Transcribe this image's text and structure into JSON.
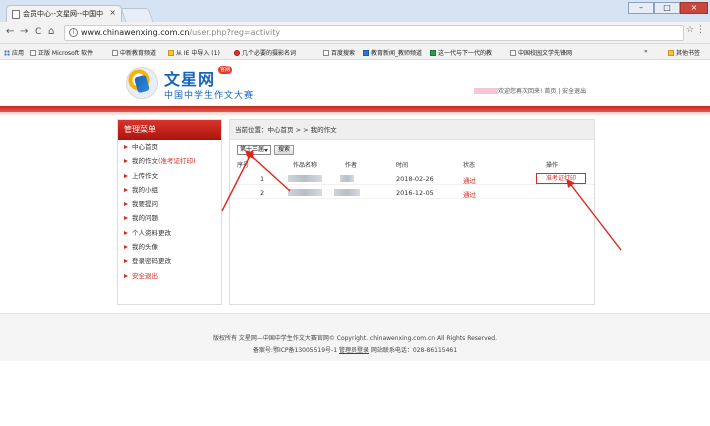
{
  "browser": {
    "tab_title": "会员中心--文星网--中国中",
    "tab_close": "×",
    "window_controls": {
      "minimize": "–",
      "maximize": "□",
      "close": "×"
    },
    "nav": {
      "back": "←",
      "forward": "→",
      "reload": "C",
      "home": "⌂"
    },
    "url_host": "www.chinawenxing.com.cn",
    "url_path": "/user.php?reg=activity",
    "bookmarks": [
      {
        "label": "应用",
        "icon": "apps-icon"
      },
      {
        "label": "正版 Microsoft 软件",
        "icon": "page-icon"
      },
      {
        "label": "中新教育频道",
        "icon": "page-icon"
      },
      {
        "label": "从 IE 中导入 (1)",
        "icon": "folder-icon"
      },
      {
        "label": "几个必要的摄影名词",
        "icon": "red-icon"
      },
      {
        "label": "百度搜索",
        "icon": "baidu-icon"
      },
      {
        "label": "教育新闻_教师频道",
        "icon": "blue-icon"
      },
      {
        "label": "这一代与下一代的教",
        "icon": "green-icon"
      },
      {
        "label": "中国校园文学先锋网",
        "icon": "page-icon"
      }
    ],
    "more_bookmarks": "»",
    "other_bookmarks": "其他书签"
  },
  "site": {
    "logo_title": "文星网",
    "logo_badge": "官网",
    "logo_subtitle": "中国中学生作文大赛",
    "welcome_text": "欢迎您再次回来! 首页 | 安全退出",
    "accent_color": "#d62b20",
    "brand_color": "#1765b8"
  },
  "sidebar": {
    "title": "管理菜单",
    "items": [
      {
        "label": "中心首页",
        "highlight": ""
      },
      {
        "label": "我的作文",
        "highlight": "(准考证打印)"
      },
      {
        "label": "上传作文",
        "highlight": ""
      },
      {
        "label": "我的小组",
        "highlight": ""
      },
      {
        "label": "我要提问",
        "highlight": ""
      },
      {
        "label": "我的问题",
        "highlight": ""
      },
      {
        "label": "个人资料更改",
        "highlight": ""
      },
      {
        "label": "我的头像",
        "highlight": ""
      },
      {
        "label": "登录密码更改",
        "highlight": ""
      },
      {
        "label": "安全退出",
        "highlight": ""
      }
    ]
  },
  "main": {
    "breadcrumb": "当前位置：中心首页 > > 我的作文",
    "filter_select": "第十三届",
    "search_button": "搜索",
    "columns": [
      "序号",
      "作品名称",
      "作者",
      "时间",
      "状态",
      "操作"
    ],
    "rows": [
      {
        "index": "1",
        "date": "2018-02-26",
        "status": "通过",
        "action": "准考证打印"
      },
      {
        "index": "2",
        "date": "2016-12-05",
        "status": "通过",
        "action": ""
      }
    ]
  },
  "footer": {
    "line1": "版权所有 文星网—中国中学生作文大赛官网© Copyright. chinawenxing.com.cn All Rights Reserved.",
    "line2_prefix": "备案号:鄂ICP备13005519号-1",
    "line2_link": "管理员登录",
    "line2_suffix": "网站联系电话：028-86115461"
  }
}
